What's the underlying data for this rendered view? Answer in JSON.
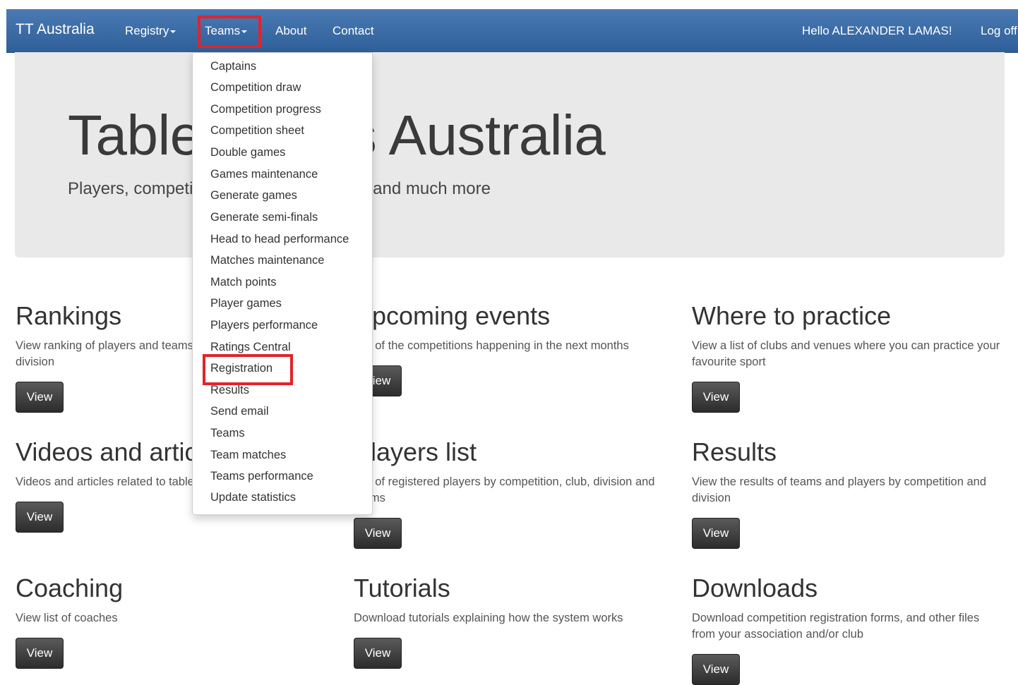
{
  "navbar": {
    "brand": "TT Australia",
    "registry": "Registry",
    "teams": "Teams",
    "about": "About",
    "contact": "Contact",
    "greeting": "Hello ALEXANDER LAMAS!",
    "logoff": "Log off"
  },
  "hero": {
    "title": "Table Tennis Australia",
    "subtitle": "Players, competitions, ranking, statistics and much more"
  },
  "teams_menu": {
    "items": [
      "Captains",
      "Competition draw",
      "Competition progress",
      "Competition sheet",
      "Double games",
      "Games maintenance",
      "Generate games",
      "Generate semi-finals",
      "Head to head performance",
      "Matches maintenance",
      "Match points",
      "Player games",
      "Players performance",
      "Ratings Central",
      "Registration",
      "Results",
      "Send email",
      "Teams",
      "Team matches",
      "Teams performance",
      "Update statistics"
    ],
    "highlighted": "Registration"
  },
  "features": [
    {
      "title": "Rankings",
      "desc": "View ranking of players and teams by competition and division",
      "button": "View"
    },
    {
      "title": "Upcoming events",
      "desc": "List of the competitions happening in the next months",
      "button": "View"
    },
    {
      "title": "Where to practice",
      "desc": "View a list of clubs and venues where you can practice your favourite sport",
      "button": "View"
    },
    {
      "title": "Videos and articles",
      "desc": "Videos and articles related to table tennis around the World",
      "button": "View"
    },
    {
      "title": "Players list",
      "desc": "List of registered players by competition, club, division and teams",
      "button": "View"
    },
    {
      "title": "Results",
      "desc": "View the results of teams and players by competition and division",
      "button": "View"
    },
    {
      "title": "Coaching",
      "desc": "View list of coaches",
      "button": "View"
    },
    {
      "title": "Tutorials",
      "desc": "Download tutorials explaining how the system works",
      "button": "View"
    },
    {
      "title": "Downloads",
      "desc": "Download competition registration forms, and other files from your association and/or club",
      "button": "View"
    }
  ],
  "colors": {
    "navbar": "#3b6ba6",
    "highlight": "#e2232a",
    "jumbotron": "#e9e9e9",
    "button": "#3a3a3a"
  }
}
